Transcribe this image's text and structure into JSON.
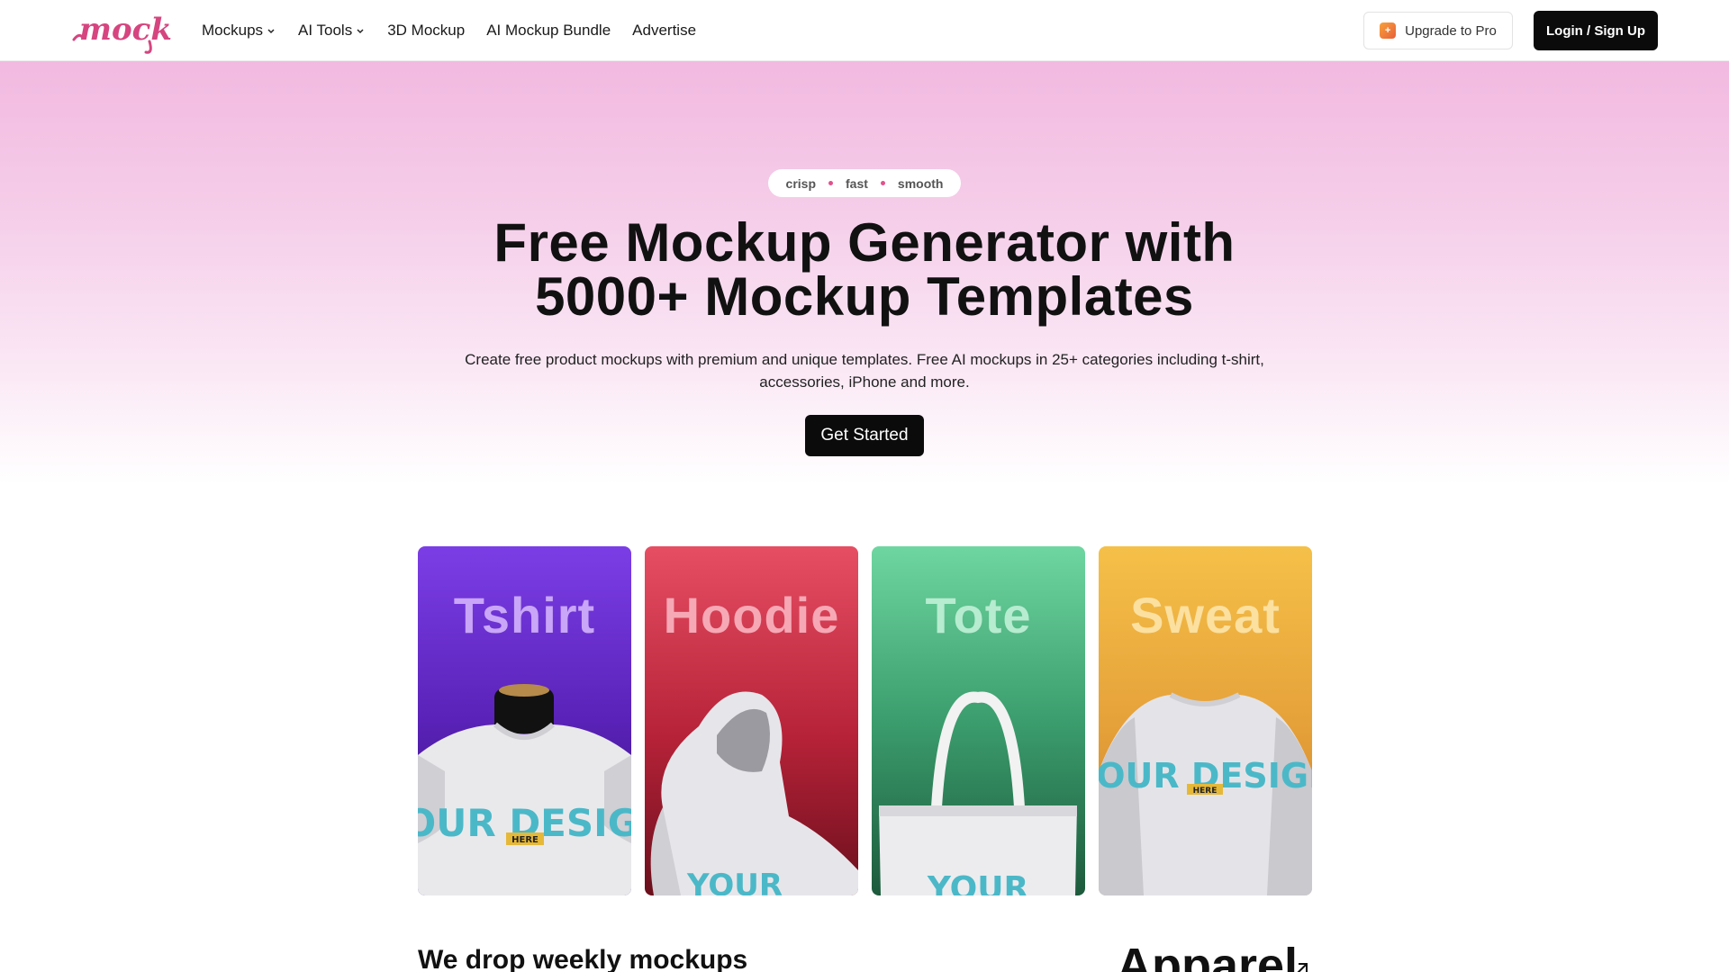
{
  "brand": {
    "logo_text": "mockey",
    "logo_color": "#d6457f"
  },
  "nav": {
    "items": [
      {
        "label": "Mockups",
        "has_dropdown": true
      },
      {
        "label": "AI Tools",
        "has_dropdown": true
      },
      {
        "label": "3D Mockup",
        "has_dropdown": false
      },
      {
        "label": "AI Mockup Bundle",
        "has_dropdown": false
      },
      {
        "label": "Advertise",
        "has_dropdown": false
      }
    ],
    "upgrade_label": "Upgrade to Pro",
    "login_label": "Login / Sign Up"
  },
  "hero": {
    "pill": [
      "crisp",
      "fast",
      "smooth"
    ],
    "headline_line1": "Free Mockup Generator with",
    "headline_line2": "5000+ Mockup Templates",
    "subtext": "Create free product mockups with premium and unique templates. Free AI mockups in 25+ categories including t-shirt, accessories, iPhone and more.",
    "cta_label": "Get Started"
  },
  "cards": [
    {
      "title": "Tshirt",
      "print_text": "YOUR DESIGN",
      "print_tag": "HERE"
    },
    {
      "title": "Hoodie",
      "print_text": "YOUR",
      "print_tag": ""
    },
    {
      "title": "Tote",
      "print_text": "YOUR",
      "print_tag": ""
    },
    {
      "title": "Sweat",
      "print_text": "YOUR DESIGN",
      "print_tag": "HERE"
    }
  ],
  "section": {
    "weekly_heading": "We drop weekly mockups",
    "category_heading": "Apparel"
  },
  "colors": {
    "accent": "#e0528c",
    "dark_button": "#0b0b0b"
  }
}
